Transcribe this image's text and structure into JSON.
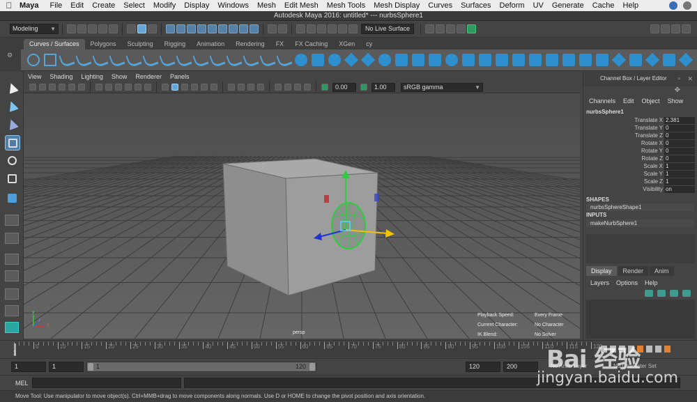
{
  "menubar": {
    "app": "Maya",
    "items": [
      "File",
      "Edit",
      "Create",
      "Select",
      "Modify",
      "Display",
      "Windows",
      "Mesh",
      "Edit Mesh",
      "Mesh Tools",
      "Mesh Display",
      "Curves",
      "Surfaces",
      "Deform",
      "UV",
      "Generate",
      "Cache",
      "Help"
    ]
  },
  "window": {
    "title": "Autodesk Maya 2016: untitled*   ---   nurbsSphere1"
  },
  "statusline": {
    "mode": "Modeling",
    "live_surface": "No Live Surface"
  },
  "shelf": {
    "tabs": [
      "Curves / Surfaces",
      "Polygons",
      "Sculpting",
      "Rigging",
      "Animation",
      "Rendering",
      "FX",
      "FX Caching",
      "XGen",
      "cy"
    ],
    "active_tab": 0
  },
  "viewport": {
    "menu": [
      "View",
      "Shading",
      "Lighting",
      "Show",
      "Renderer",
      "Panels"
    ],
    "exposure": "0.00",
    "gamma": "1.00",
    "color_space": "sRGB gamma",
    "camera": "persp",
    "hud": [
      {
        "label": "Playback Speed:",
        "value": "Every Frame"
      },
      {
        "label": "Current Character:",
        "value": "No Character"
      },
      {
        "label": "IK Blend:",
        "value": "No Solver"
      }
    ],
    "axis_labels": {
      "x": "x",
      "y": "y",
      "z": "z"
    }
  },
  "channel_box": {
    "title": "Channel Box / Layer Editor",
    "menu": [
      "Channels",
      "Edit",
      "Object",
      "Show"
    ],
    "object": "nurbsSphere1",
    "attributes": [
      {
        "name": "Translate X",
        "value": "2.381"
      },
      {
        "name": "Translate Y",
        "value": "0"
      },
      {
        "name": "Translate Z",
        "value": "0"
      },
      {
        "name": "Rotate X",
        "value": "0"
      },
      {
        "name": "Rotate Y",
        "value": "0"
      },
      {
        "name": "Rotate Z",
        "value": "0"
      },
      {
        "name": "Scale X",
        "value": "1"
      },
      {
        "name": "Scale Y",
        "value": "1"
      },
      {
        "name": "Scale Z",
        "value": "1"
      },
      {
        "name": "Visibility",
        "value": "on"
      }
    ],
    "shapes_label": "SHAPES",
    "shape": "nurbsSphereShape1",
    "inputs_label": "INPUTS",
    "input": "makeNurbSphere1"
  },
  "layer_editor": {
    "tabs": [
      "Display",
      "Render",
      "Anim"
    ],
    "active_tab": 0,
    "menu": [
      "Layers",
      "Options",
      "Help"
    ]
  },
  "timeline": {
    "ticks": [
      "5",
      "10",
      "15",
      "20",
      "25",
      "30",
      "35",
      "40",
      "45",
      "50",
      "55",
      "60",
      "65",
      "70",
      "75",
      "80",
      "85",
      "90",
      "95",
      "100",
      "105",
      "110",
      "115",
      "120"
    ],
    "current_frame": "1"
  },
  "range": {
    "start": "1",
    "current": "1",
    "range_start": "1",
    "range_end": "120",
    "end": "120",
    "anim_end": "200",
    "anim_layer": "No Anim Layer",
    "char_set": "No Character Set"
  },
  "command": {
    "language": "MEL"
  },
  "help": {
    "text": "Move Tool: Use manipulator to move object(s). Ctrl+MMB+drag to move components along normals. Use D or HOME to change the pivot position and axis orientation."
  },
  "watermark": {
    "brand": "Bai 经验",
    "url": "jingyan.baidu.com"
  },
  "colors": {
    "accent": "#54a5d8",
    "bg": "#444444",
    "grid": "#5d5d5d",
    "selection": "#2ecc40"
  }
}
